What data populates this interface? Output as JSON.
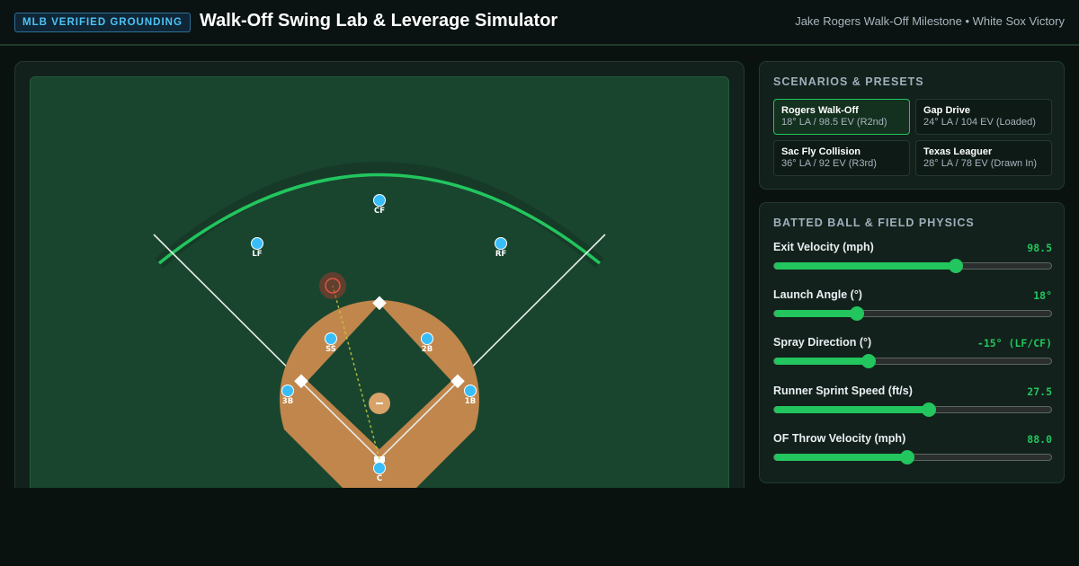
{
  "header": {
    "badge": "MLB VERIFIED GROUNDING",
    "title": "Walk-Off Swing Lab & Leverage Simulator",
    "subtitle": "Jake Rogers Walk-Off Milestone • White Sox Victory"
  },
  "field": {
    "fielders": [
      "CF",
      "LF",
      "RF",
      "SS",
      "2B",
      "3B",
      "1B",
      "C"
    ],
    "mound_icon": "minus-icon",
    "landing_marker_icon": "target-ring-icon",
    "colors": {
      "grass": "#19452f",
      "dirt": "#c0864c",
      "warning_track_wall": "#22c55e",
      "fielder": "#38bdf8",
      "landing_marker": "#e05545",
      "trajectory": "#c7c93a"
    }
  },
  "scenarios": {
    "title": "SCENARIOS & PRESETS",
    "presets": [
      {
        "name": "Rogers Walk-Off",
        "desc": "18° LA / 98.5 EV (R2nd)",
        "active": true
      },
      {
        "name": "Gap Drive",
        "desc": "24° LA / 104 EV (Loaded)",
        "active": false
      },
      {
        "name": "Sac Fly Collision",
        "desc": "36° LA / 92 EV (R3rd)",
        "active": false
      },
      {
        "name": "Texas Leaguer",
        "desc": "28° LA / 78 EV (Drawn In)",
        "active": false
      }
    ]
  },
  "physics": {
    "title": "BATTED BALL & FIELD PHYSICS",
    "sliders": [
      {
        "label": "Exit Velocity (mph)",
        "value": "98.5",
        "fraction": 0.655
      },
      {
        "label": "Launch Angle (°)",
        "value": "18°",
        "fraction": 0.3
      },
      {
        "label": "Spray Direction (°)",
        "value": "-15° (LF/CF)",
        "fraction": 0.34
      },
      {
        "label": "Runner Sprint Speed (ft/s)",
        "value": "27.5",
        "fraction": 0.56
      },
      {
        "label": "OF Throw Velocity (mph)",
        "value": "88.0",
        "fraction": 0.48
      }
    ],
    "accent": "#22c55e"
  }
}
